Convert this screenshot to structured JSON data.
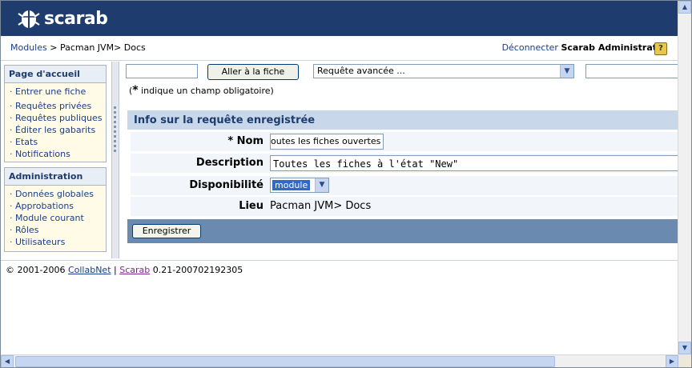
{
  "header": {
    "logo_text": "scarab"
  },
  "breadcrumb": {
    "modules_link": "Modules",
    "sep": ">",
    "path": "Pacman JVM> Docs",
    "disconnect_link": "Déconnecter",
    "user_name": "Scarab Administrator",
    "help_icon_text": "?"
  },
  "sidebar": {
    "home": {
      "title": "Page d'accueil",
      "items": [
        "Entrer une fiche",
        "Requêtes privées",
        "Requêtes publiques",
        "Éditer les gabarits",
        "Etats",
        "Notifications"
      ]
    },
    "admin": {
      "title": "Administration",
      "items": [
        "Données globales",
        "Approbations",
        "Module courant",
        "Rôles",
        "Utilisateurs"
      ]
    }
  },
  "toolbar": {
    "goto_button": "Aller à la fiche",
    "query_select": "Requête avancée ..."
  },
  "required_note": {
    "star": "*",
    "text": " indique un champ obligatoire)",
    "open": "("
  },
  "form": {
    "title": "Info sur la requête enregistrée",
    "name_label": "* Nom",
    "name_value": "outes les fiches ouvertes",
    "description_label": "Description",
    "description_value": "Toutes les fiches à l'état \"New\"",
    "availability_label": "Disponibilité",
    "availability_value": "module",
    "location_label": "Lieu",
    "location_value": "Pacman JVM> Docs",
    "save_button": "Enregistrer"
  },
  "footer": {
    "copyright": "© 2001-2006 ",
    "collabnet": "CollabNet",
    "pipe": " | ",
    "scarab": "Scarab",
    "version": " 0.21-200702192305"
  }
}
